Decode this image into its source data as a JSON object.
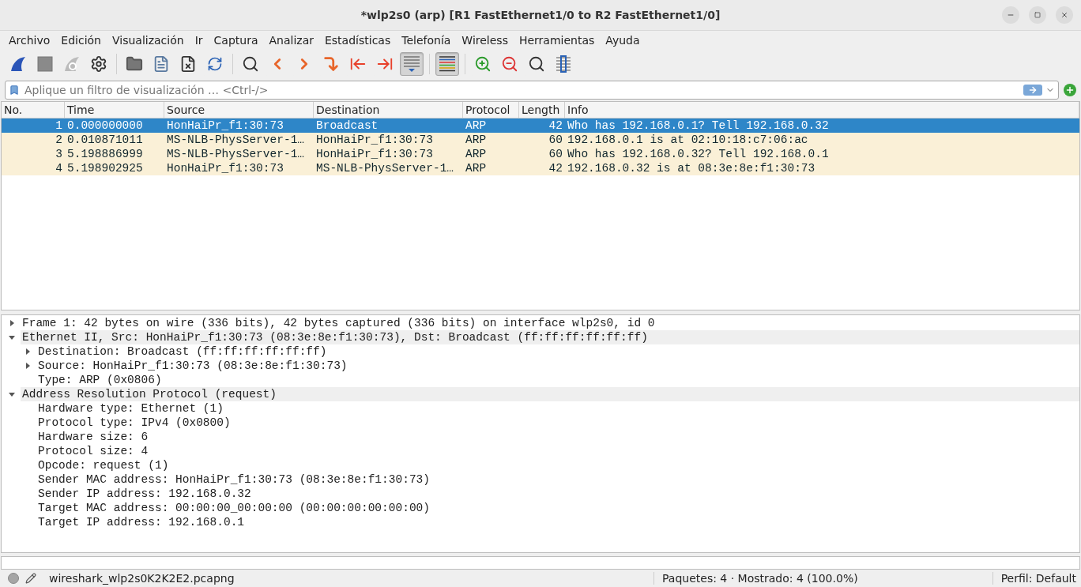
{
  "window": {
    "title": "*wlp2s0 (arp) [R1 FastEthernet1/0 to R2 FastEthernet1/0]"
  },
  "menu": [
    "Archivo",
    "Edición",
    "Visualización",
    "Ir",
    "Captura",
    "Analizar",
    "Estadísticas",
    "Telefonía",
    "Wireless",
    "Herramientas",
    "Ayuda"
  ],
  "toolbar": [
    {
      "kind": "start",
      "pressed": false
    },
    {
      "kind": "stop",
      "pressed": false
    },
    {
      "kind": "restart",
      "pressed": false
    },
    {
      "kind": "options",
      "pressed": false
    },
    {
      "kind": "sep"
    },
    {
      "kind": "open",
      "pressed": false
    },
    {
      "kind": "save",
      "pressed": false
    },
    {
      "kind": "close",
      "pressed": false
    },
    {
      "kind": "reload",
      "pressed": false
    },
    {
      "kind": "sep"
    },
    {
      "kind": "find",
      "pressed": false
    },
    {
      "kind": "back",
      "pressed": false
    },
    {
      "kind": "forward",
      "pressed": false
    },
    {
      "kind": "goto",
      "pressed": false
    },
    {
      "kind": "first",
      "pressed": false
    },
    {
      "kind": "last",
      "pressed": false
    },
    {
      "kind": "autoscroll",
      "pressed": true
    },
    {
      "kind": "sep"
    },
    {
      "kind": "colorize",
      "pressed": true
    },
    {
      "kind": "sep"
    },
    {
      "kind": "zoomin",
      "pressed": false
    },
    {
      "kind": "zoomout",
      "pressed": false
    },
    {
      "kind": "zoomreset",
      "pressed": false
    },
    {
      "kind": "resize",
      "pressed": false
    }
  ],
  "filter": {
    "placeholder": "Aplique un filtro de visualización … <Ctrl-/>"
  },
  "table": {
    "columns": [
      "No.",
      "Time",
      "Source",
      "Destination",
      "Protocol",
      "Length",
      "Info"
    ],
    "rows": [
      {
        "selected": true,
        "cells": [
          "1",
          "0.000000000",
          "HonHaiPr_f1:30:73",
          "Broadcast",
          "ARP",
          "42",
          "Who has 192.168.0.1? Tell 192.168.0.32"
        ]
      },
      {
        "selected": false,
        "cells": [
          "2",
          "0.010871011",
          "MS-NLB-PhysServer-1…",
          "HonHaiPr_f1:30:73",
          "ARP",
          "60",
          "192.168.0.1 is at 02:10:18:c7:06:ac"
        ]
      },
      {
        "selected": false,
        "cells": [
          "3",
          "5.198886999",
          "MS-NLB-PhysServer-1…",
          "HonHaiPr_f1:30:73",
          "ARP",
          "60",
          "Who has 192.168.0.32? Tell 192.168.0.1"
        ]
      },
      {
        "selected": false,
        "cells": [
          "4",
          "5.198902925",
          "HonHaiPr_f1:30:73",
          "MS-NLB-PhysServer-1…",
          "ARP",
          "42",
          "192.168.0.32 is at 08:3e:8e:f1:30:73"
        ]
      }
    ]
  },
  "details": [
    {
      "text": "Frame 1: 42 bytes on wire (336 bits), 42 bytes captured (336 bits) on interface wlp2s0, id 0",
      "expanded": false
    },
    {
      "text": "Ethernet II, Src: HonHaiPr_f1:30:73 (08:3e:8e:f1:30:73), Dst: Broadcast (ff:ff:ff:ff:ff:ff)",
      "expanded": true,
      "children": [
        {
          "text": "Destination: Broadcast (ff:ff:ff:ff:ff:ff)",
          "expanded": false,
          "expandable": true
        },
        {
          "text": "Source: HonHaiPr_f1:30:73 (08:3e:8e:f1:30:73)",
          "expanded": false,
          "expandable": true
        },
        {
          "text": "Type: ARP (0x0806)",
          "expandable": false
        }
      ]
    },
    {
      "text": "Address Resolution Protocol (request)",
      "expanded": true,
      "children": [
        {
          "text": "Hardware type: Ethernet (1)",
          "expandable": false
        },
        {
          "text": "Protocol type: IPv4 (0x0800)",
          "expandable": false
        },
        {
          "text": "Hardware size: 6",
          "expandable": false
        },
        {
          "text": "Protocol size: 4",
          "expandable": false
        },
        {
          "text": "Opcode: request (1)",
          "expandable": false
        },
        {
          "text": "Sender MAC address: HonHaiPr_f1:30:73 (08:3e:8e:f1:30:73)",
          "expandable": false
        },
        {
          "text": "Sender IP address: 192.168.0.32",
          "expandable": false
        },
        {
          "text": "Target MAC address: 00:00:00_00:00:00 (00:00:00:00:00:00)",
          "expandable": false
        },
        {
          "text": "Target IP address: 192.168.0.1",
          "expandable": false
        }
      ]
    }
  ],
  "status_bar": {
    "file": "wireshark_wlp2s0K2K2E2.pcapng",
    "packets": "Paquetes: 4 · Mostrado: 4 (100.0%)",
    "profile": "Perfil: Default"
  }
}
